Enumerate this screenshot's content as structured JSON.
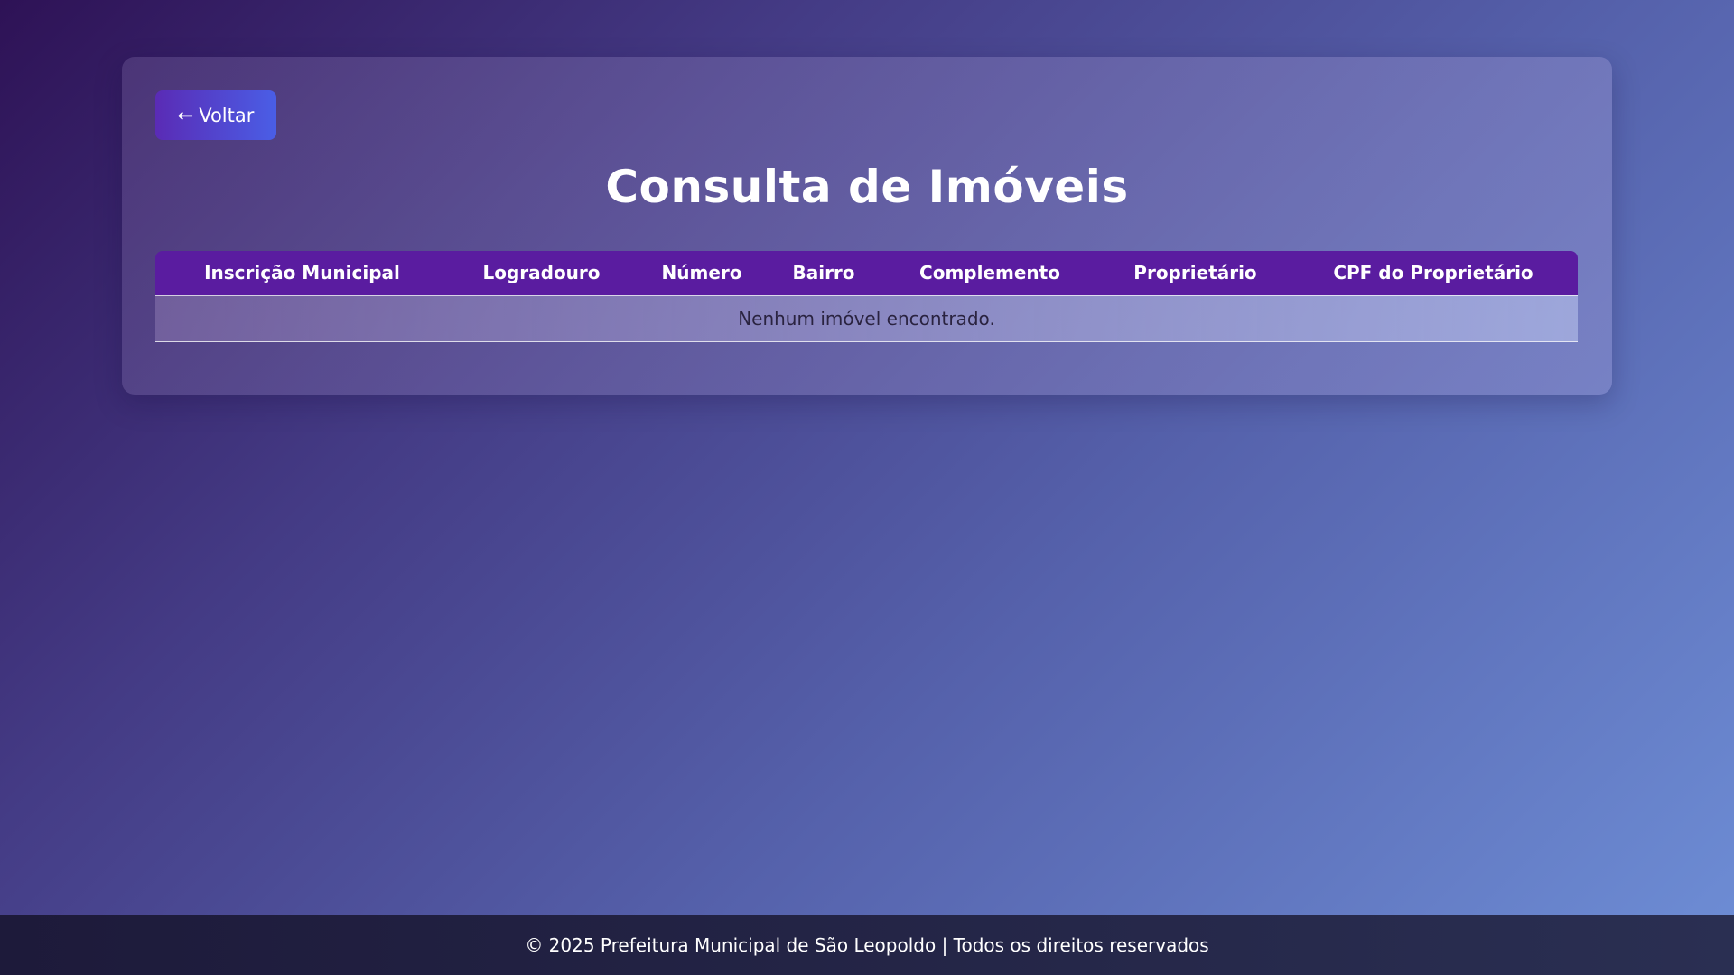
{
  "back_button": {
    "arrow": "←",
    "label": "Voltar"
  },
  "page": {
    "title": "Consulta de Imóveis"
  },
  "table": {
    "columns": [
      "Inscrição Municipal",
      "Logradouro",
      "Número",
      "Bairro",
      "Complemento",
      "Proprietário",
      "CPF do Proprietário"
    ],
    "empty_message": "Nenhum imóvel encontrado."
  },
  "footer": {
    "text": "© 2025 Prefeitura Municipal de São Leopoldo | Todos os direitos reservados"
  },
  "colors": {
    "header_bg": "#5a1ca0",
    "button_start": "#5a2bb5",
    "button_end": "#4a5ee6"
  }
}
